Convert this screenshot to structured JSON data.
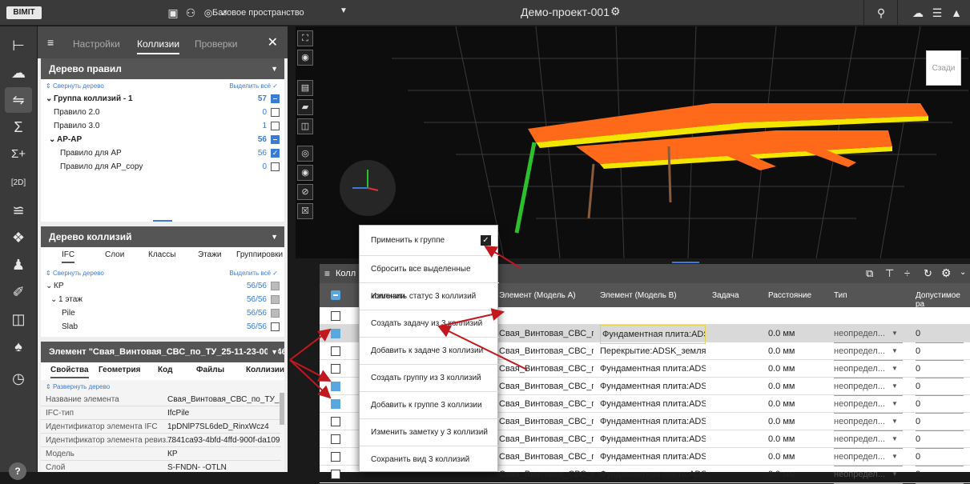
{
  "topbar": {
    "logo": "BIMIT",
    "space_label": "Базовое пространство",
    "project_title": "Демо-проект-001",
    "icons": [
      "briefcase-icon",
      "people-icon",
      "chart-icon",
      "check-circle-icon",
      "settings-icon",
      "search-icon",
      "cloud-icon",
      "list-icon",
      "bell-icon"
    ]
  },
  "leftbar": {
    "items": [
      "tree-icon",
      "cloud-icon",
      "collisions-icon",
      "sum-icon",
      "sum-plus-icon",
      "2d-icon",
      "layers-icon",
      "puzzle-icon",
      "user-edit-icon",
      "draw-icon",
      "folder-icon",
      "user-location-icon",
      "clock-icon"
    ],
    "help": "?"
  },
  "panel": {
    "tabs": [
      "Настройки",
      "Коллизии",
      "Проверки"
    ],
    "active_tab": "Коллизии",
    "rules_tree": {
      "title": "Дерево правил",
      "collapse": "Свернуть дерево",
      "select_all": "Выделить всё",
      "rows": [
        {
          "label": "Группа коллизий - 1",
          "count": "57",
          "state": "partial"
        },
        {
          "label": "Правило 2.0",
          "count": "0",
          "state": "none"
        },
        {
          "label": "Правило 3.0",
          "count": "1",
          "state": "none"
        },
        {
          "label": "АР-АР",
          "count": "56",
          "state": "partial"
        },
        {
          "label": "Правило для АР",
          "count": "56",
          "state": "checked"
        },
        {
          "label": "Правило для АР_copy",
          "count": "0",
          "state": "none"
        }
      ]
    },
    "collision_tree": {
      "title": "Дерево коллизий",
      "tabs": [
        "IFC",
        "Слои",
        "Классы",
        "Этажи",
        "Группировки"
      ],
      "collapse": "Свернуть дерево",
      "select_all": "Выделить всё",
      "rows": [
        {
          "label": "КР",
          "count": "56/56"
        },
        {
          "label": "1 этаж",
          "count": "56/56"
        },
        {
          "label": "Pile",
          "count": "56/56"
        },
        {
          "label": "Slab",
          "count": "56/56"
        }
      ]
    },
    "element": {
      "title": "Элемент \"Свая_Винтовая_СВС_по_ТУ_25-11-23-001-469...",
      "tabs": [
        "Свойства",
        "Геометрия",
        "Код",
        "Файлы",
        "Коллизии"
      ],
      "expand": "Развернуть дерево",
      "props": [
        {
          "k": "Название элемента",
          "v": "Свая_Винтовая_СВС_по_ТУ_25-1..."
        },
        {
          "k": "IFC-тип",
          "v": "IfcPile"
        },
        {
          "k": "Идентификатор элемента IFC",
          "v": "1pDNlP7SL6deD_RinxWcz4"
        },
        {
          "k": "Идентификатор элемента ревиз...",
          "v": "7841ca93-4bfd-4ffd-900f-da109e7..."
        },
        {
          "k": "Модель",
          "v": "КР"
        },
        {
          "k": "Слой",
          "v": "S-FNDN-    -OTLN"
        }
      ]
    }
  },
  "viewport": {
    "navcube_label": "Сзади",
    "tools": [
      "expand-icon",
      "target-icon",
      "measure-icon",
      "section-icon",
      "cube-section-icon",
      "focus-icon",
      "eye-icon",
      "eye-off-icon",
      "close-box-icon"
    ]
  },
  "table": {
    "title": "Колл",
    "columns": [
      "Элемент (Модель А)",
      "Элемент (Модель В)",
      "Задача",
      "Расстояние",
      "Тип",
      "Допустимое ра"
    ],
    "rows": [
      {
        "checked": false,
        "a": "",
        "b": "",
        "task": "",
        "dist": "",
        "type": "",
        "tol": ""
      },
      {
        "checked": true,
        "a": "Свая_Винтовая_СВС_по_ТУ",
        "b": "Фундаментная плита:ADSK_",
        "task": "",
        "dist": "0.0 мм",
        "type": "неопредел...",
        "tol": "0"
      },
      {
        "checked": false,
        "a": "Свая_Винтовая_СВС_по_ТУ",
        "b": "Перекрытие:ADSK_земля:10",
        "task": "",
        "dist": "0.0 мм",
        "type": "неопредел...",
        "tol": "0"
      },
      {
        "checked": false,
        "a": "Свая_Винтовая_СВС_по_ТУ",
        "b": "Фундаментная плита:ADSK_",
        "task": "",
        "dist": "0.0 мм",
        "type": "неопредел...",
        "tol": "0"
      },
      {
        "checked": true,
        "a": "Свая_Винтовая_СВС_по_ТУ",
        "b": "Фундаментная плита:ADSK_",
        "task": "",
        "dist": "0.0 мм",
        "type": "неопредел...",
        "tol": "0"
      },
      {
        "checked": true,
        "a": "Свая_Винтовая_СВС_по_ТУ",
        "b": "Фундаментная плита:ADSK_",
        "task": "",
        "dist": "0.0 мм",
        "type": "неопредел...",
        "tol": "0"
      },
      {
        "checked": false,
        "a": "Свая_Винтовая_СВС_по_ТУ",
        "b": "Фундаментная плита:ADSK_",
        "task": "",
        "dist": "0.0 мм",
        "type": "неопредел...",
        "tol": "0"
      },
      {
        "checked": false,
        "a": "Свая_Винтовая_СВС_по_ТУ",
        "b": "Фундаментная плита:ADSK_",
        "task": "",
        "dist": "0.0 мм",
        "type": "неопредел...",
        "tol": "0"
      },
      {
        "checked": false,
        "a": "Свая_Винтовая_СВС_по_ТУ",
        "b": "Фундаментная плита:ADSK_",
        "task": "",
        "dist": "0.0 мм",
        "type": "неопредел...",
        "tol": "0"
      },
      {
        "checked": false,
        "a": "Свая_Винтовая_СВС_по_ТУ",
        "b": "Фундаментная плита:ADSK_",
        "task": "",
        "dist": "0.0 мм",
        "type": "неопредел...",
        "tol": "0"
      }
    ]
  },
  "context_menu": {
    "items": [
      "Применить к группе",
      "Сбросить все выделенные коллизии",
      "Изменить статус 3 коллизий",
      "Создать задачу из 3 коллизий",
      "Добавить к задаче 3 коллизии",
      "Создать группу из 3 коллизий",
      "Добавить к группе 3 коллизии",
      "Изменить заметку у 3 коллизий",
      "Сохранить вид 3 коллизий"
    ]
  },
  "colors": {
    "accent": "#3b7bd4",
    "arrow": "#c0181e",
    "model_orange": "#ff6a1a",
    "model_yellow": "#f2e600"
  }
}
